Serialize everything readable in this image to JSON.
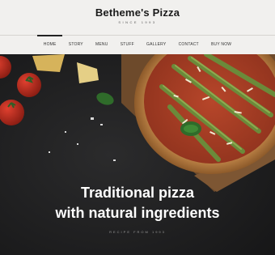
{
  "brand": {
    "name": "Betheme's Pizza",
    "tagline": "SINCE 1993"
  },
  "nav": {
    "items": [
      {
        "label": "HOME",
        "active": true
      },
      {
        "label": "STORY"
      },
      {
        "label": "MENU"
      },
      {
        "label": "STUFF"
      },
      {
        "label": "GALLERY"
      },
      {
        "label": "CONTACT"
      },
      {
        "label": "BUY NOW"
      }
    ]
  },
  "hero": {
    "headline_line1": "Traditional pizza",
    "headline_line2": "with natural ingredients",
    "subtext": "RECIPE FROM 1993"
  },
  "colors": {
    "header_bg": "#f1f0ee",
    "hero_bg": "#1f1f20",
    "text_light": "#ffffff"
  }
}
